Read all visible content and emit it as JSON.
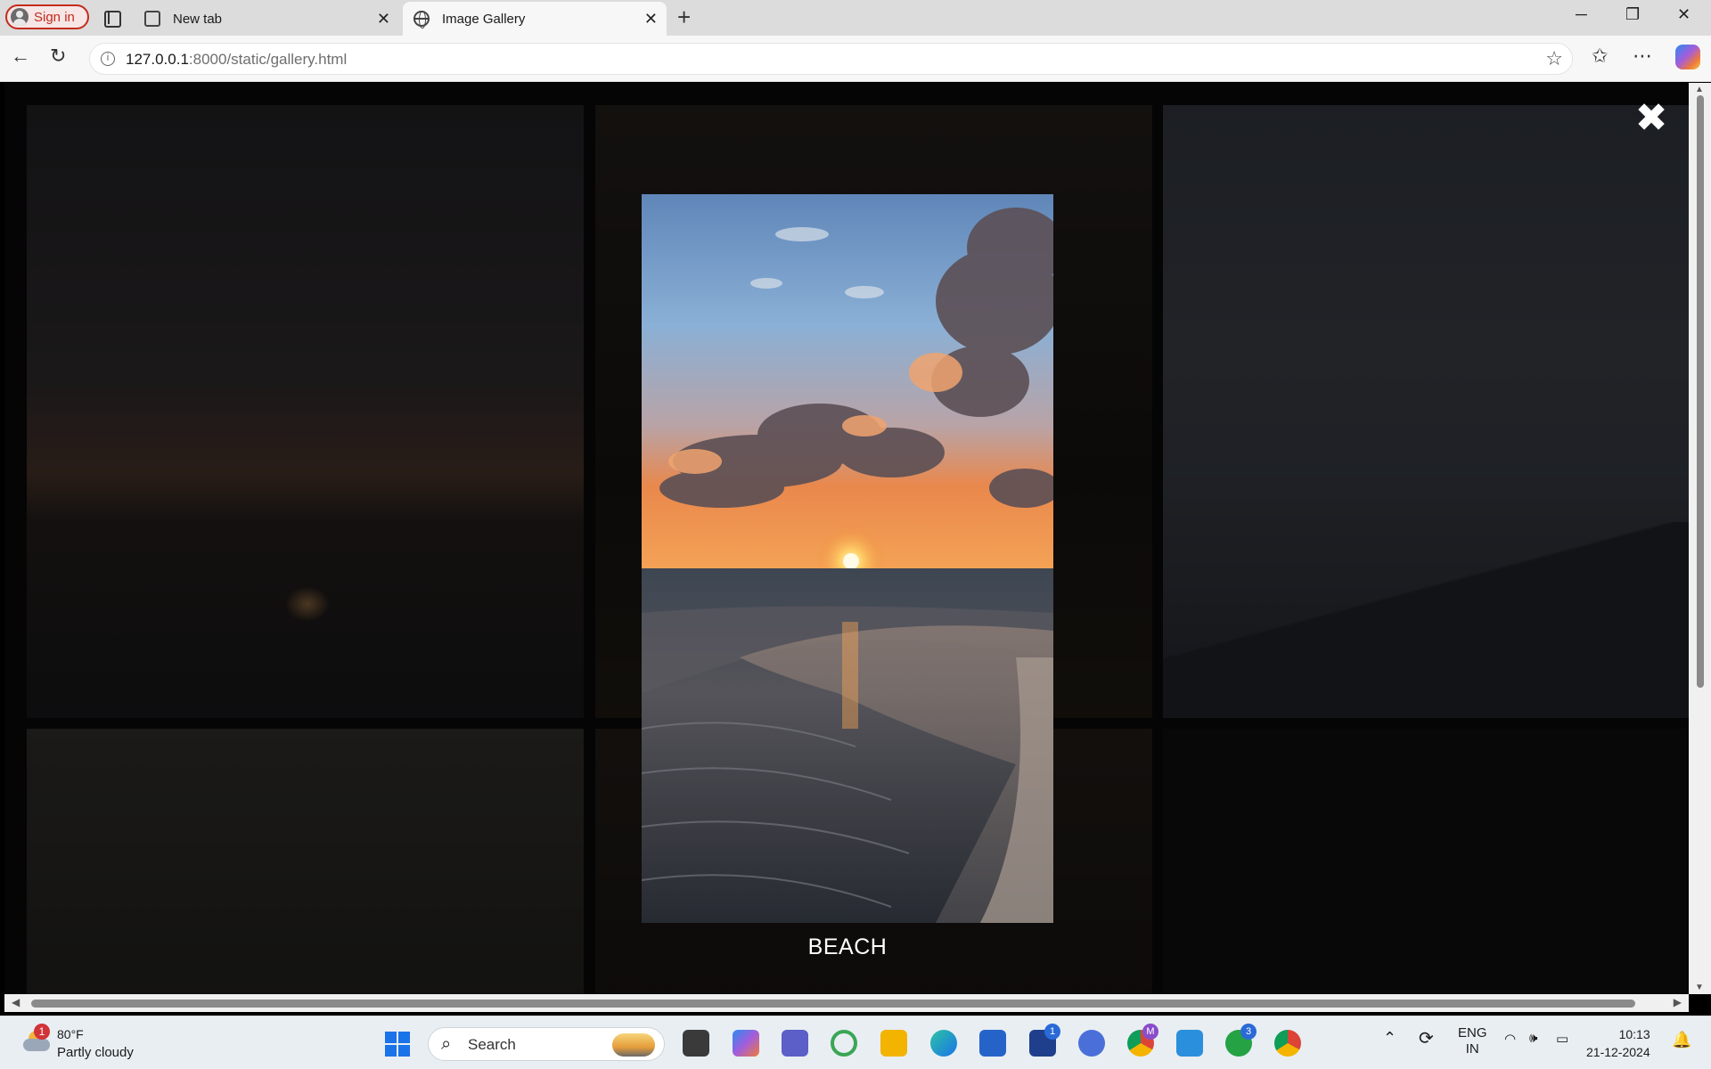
{
  "browser": {
    "signin_label": "Sign in",
    "tabs": [
      {
        "title": "New tab",
        "active": false
      },
      {
        "title": "Image Gallery",
        "active": true
      }
    ],
    "url_host": "127.0.0.1",
    "url_path": ":8000/static/gallery.html"
  },
  "gallery": {
    "close_symbol": "✖",
    "lightbox_caption": "BEACH",
    "thumbnails": [
      {
        "subject": "sunset-sea"
      },
      {
        "subject": "dark-foliage"
      },
      {
        "subject": "mountains-clouds"
      },
      {
        "subject": "bright-sky-branches"
      },
      {
        "subject": "flowers-dark"
      },
      {
        "subject": "plant-dark"
      }
    ]
  },
  "taskbar": {
    "weather_badge": "1",
    "weather_temp": "80°F",
    "weather_condition": "Partly cloudy",
    "search_placeholder": "Search",
    "apps": [
      {
        "name": "task-view"
      },
      {
        "name": "copilot"
      },
      {
        "name": "teams"
      },
      {
        "name": "refresh-app"
      },
      {
        "name": "file-explorer"
      },
      {
        "name": "edge"
      },
      {
        "name": "store"
      },
      {
        "name": "l-app",
        "badge": "1"
      },
      {
        "name": "vpn-app"
      },
      {
        "name": "chrome-profile",
        "badge": "M"
      },
      {
        "name": "vscode"
      },
      {
        "name": "whatsapp",
        "badge": "3"
      },
      {
        "name": "chrome"
      }
    ],
    "lang_top": "ENG",
    "lang_bottom": "IN",
    "time": "10:13",
    "date": "21-12-2024"
  },
  "colors": {
    "accent": "#1a73e8",
    "signin_red": "#c42b1c",
    "page_bg": "#0d0d0d"
  }
}
